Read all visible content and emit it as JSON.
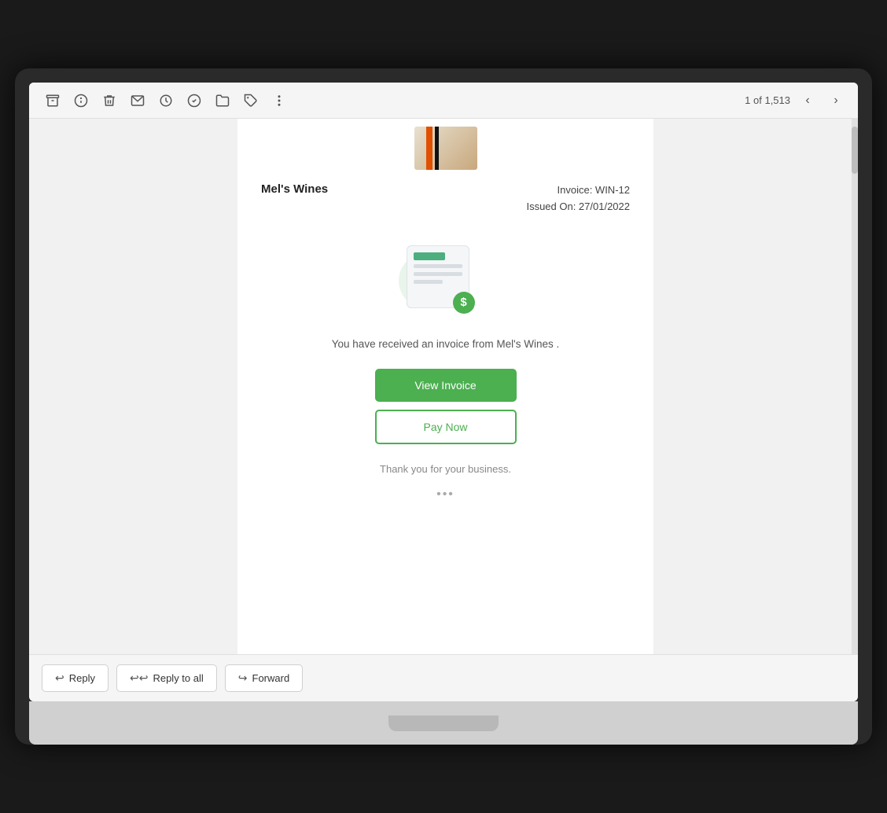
{
  "toolbar": {
    "pagination_text": "1 of 1,513",
    "icons": [
      "archive",
      "info",
      "trash",
      "mail",
      "clock",
      "tag-check",
      "folder",
      "label",
      "more-vertical"
    ]
  },
  "email": {
    "company": "Mel's Wines",
    "invoice_number": "Invoice: WIN-12",
    "issued_on": "Issued On: 27/01/2022",
    "message": "You have received an invoice from Mel's Wines .",
    "view_invoice_label": "View Invoice",
    "pay_now_label": "Pay Now",
    "footer_text": "Thank you for your business.",
    "ellipsis": "•••"
  },
  "actions": {
    "reply_label": "Reply",
    "reply_all_label": "Reply to all",
    "forward_label": "Forward"
  }
}
